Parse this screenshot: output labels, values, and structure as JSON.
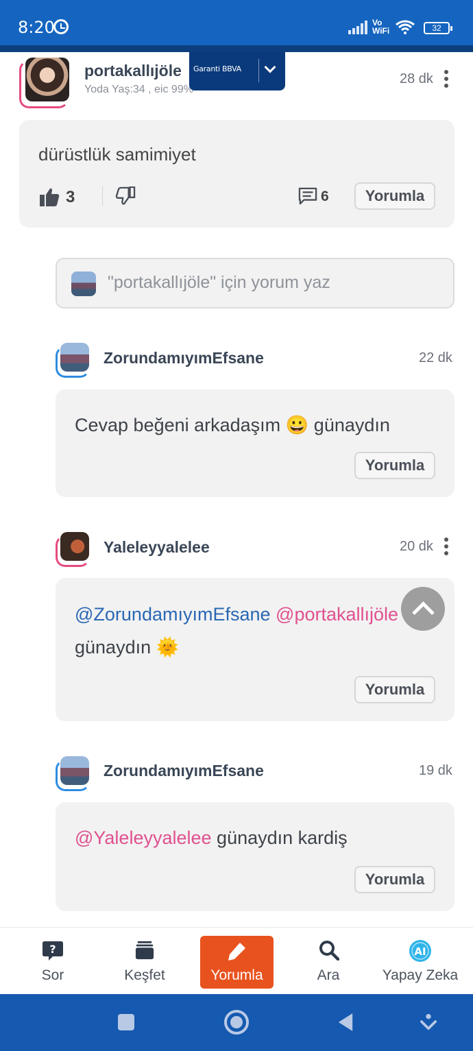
{
  "status_bar": {
    "time": "8:20",
    "vowifi": [
      "Vo",
      "WiFi"
    ],
    "battery": "32"
  },
  "ad": {
    "brand": "Garanti BBVA"
  },
  "post": {
    "username": "portakallıjöle",
    "subtitle": "Yoda Yaş:34 , eic 99%",
    "time": "28 dk",
    "text": "dürüstlük samimiyet",
    "likes": "3",
    "comments": "6",
    "reply_label": "Yorumla"
  },
  "comment_input": {
    "placeholder": "\"portakallıjöle\" için yorum yaz"
  },
  "replies": [
    {
      "username": "ZorundamıyımEfsane",
      "time": "22 dk",
      "text": "Cevap beğeni arkadaşım 😀 günaydın",
      "reply_label": "Yorumla"
    },
    {
      "username": "Yaleleyyalelee",
      "time": "20 dk",
      "mention1": "@ZorundamıyımEfsane",
      "mention2": "@portakallıjöle",
      "text": "günaydın 🌞",
      "reply_label": "Yorumla"
    },
    {
      "username": "ZorundamıyımEfsane",
      "time": "19 dk",
      "mention": "@Yaleleyyalelee",
      "text": "günaydın kardiş",
      "reply_label": "Yorumla"
    }
  ],
  "bottom_nav": [
    {
      "label": "Sor",
      "icon": "question-bubble-icon"
    },
    {
      "label": "Keşfet",
      "icon": "stack-icon"
    },
    {
      "label": "Yorumla",
      "icon": "pencil-icon",
      "active": true
    },
    {
      "label": "Ara",
      "icon": "search-icon"
    },
    {
      "label": "Yapay Zeka",
      "icon": "ai-icon"
    }
  ],
  "colors": {
    "primary_blue": "#1565c0",
    "active_orange": "#e8521e",
    "mention_blue": "#2a67b4",
    "mention_pink": "#e0508f"
  }
}
